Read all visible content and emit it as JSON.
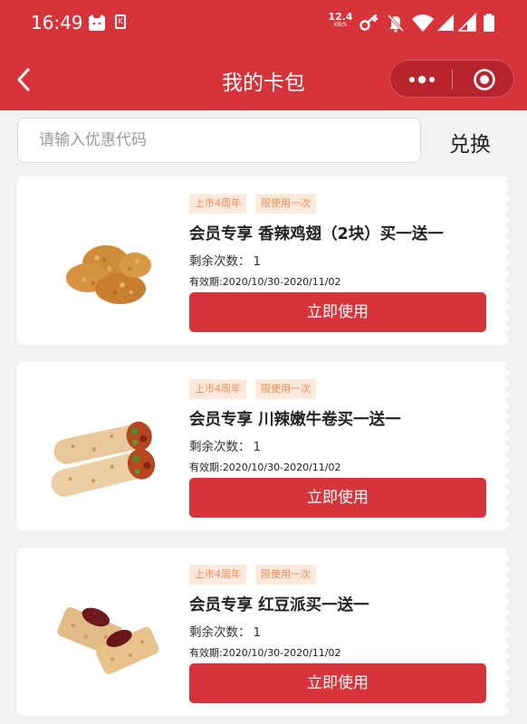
{
  "status_bar": {
    "time": "16:49",
    "net_speed": "12.4",
    "net_unit": "KB/S",
    "k_badge": "K",
    "icons": [
      "cat-icon",
      "k-badge-icon",
      "key-icon",
      "bell-off-icon",
      "wifi-icon",
      "signal-icon",
      "signal-icon",
      "battery-icon"
    ]
  },
  "nav": {
    "title": "我的卡包",
    "back_icon": "chevron-left-icon",
    "capsule_icons": [
      "more-dots-icon",
      "close-target-icon"
    ]
  },
  "search": {
    "placeholder": "请输入优惠代码",
    "value": "",
    "redeem_label": "兑换"
  },
  "coupons": [
    {
      "image": "chicken-wings-image",
      "tag1": "上市4周年",
      "tag2": "限使用一次",
      "title": "会员专享 香辣鸡翅（2块）买一送一",
      "remaining_label": "剩余次数：",
      "remaining": "1",
      "validity": "有效期:2020/10/30-2020/11/02",
      "button": "立即使用"
    },
    {
      "image": "beef-wrap-image",
      "tag1": "上市4周年",
      "tag2": "限使用一次",
      "title": "会员专享 川辣嫩牛卷买一送一",
      "remaining_label": "剩余次数：",
      "remaining": "1",
      "validity": "有效期:2020/10/30-2020/11/02",
      "button": "立即使用"
    },
    {
      "image": "red-bean-pie-image",
      "tag1": "上市4周年",
      "tag2": "限使用一次",
      "title": "会员专享 红豆派买一送一",
      "remaining_label": "剩余次数：",
      "remaining": "1",
      "validity": "有效期:2020/10/30-2020/11/02",
      "button": "立即使用"
    }
  ],
  "colors": {
    "brand_red": "#d7333a",
    "tag_bg": "#fde8dc",
    "tag_text": "#f08a55",
    "page_bg": "#f2f2f2"
  }
}
